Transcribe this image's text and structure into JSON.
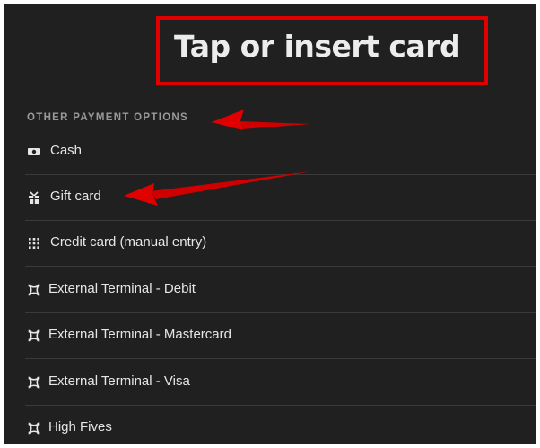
{
  "header": {
    "title": "Tap or insert card"
  },
  "payment_options": {
    "heading": "OTHER PAYMENT OPTIONS",
    "items": [
      {
        "label": "Cash",
        "icon": "cash-icon"
      },
      {
        "label": "Gift card",
        "icon": "gift-icon"
      },
      {
        "label": "Credit card (manual entry)",
        "icon": "keypad-icon"
      },
      {
        "label": "External Terminal - Debit",
        "icon": "terminal-icon"
      },
      {
        "label": "External Terminal - Mastercard",
        "icon": "terminal-icon"
      },
      {
        "label": "External Terminal - Visa",
        "icon": "terminal-icon"
      },
      {
        "label": "High Fives",
        "icon": "terminal-icon"
      }
    ]
  },
  "colors": {
    "background": "#202020",
    "text": "#e6e6e6",
    "heading": "#9a9a9a",
    "annotation": "#e00000",
    "divider": "#3a3a3a"
  }
}
